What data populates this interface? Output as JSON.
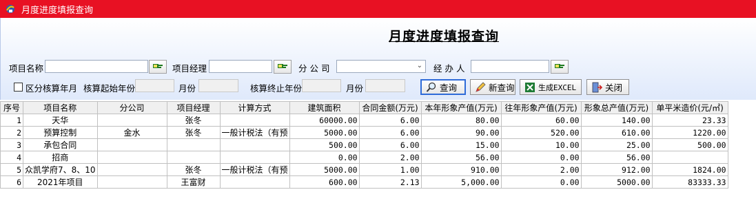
{
  "window": {
    "title": "月度进度填报查询"
  },
  "heading": "月度进度填报查询",
  "filters": {
    "project_name_label": "项目名称",
    "project_name_value": "",
    "manager_label": "项目经理",
    "manager_value": "",
    "branch_label": "分 公 司",
    "branch_value": "",
    "handler_label": "经 办 人",
    "handler_value": "",
    "split_label": "区分核算年月",
    "split_checked": false,
    "start_year_label": "核算起始年份",
    "start_month_label": "月份",
    "end_year_label": "核算终止年份",
    "end_month_label": "月份"
  },
  "buttons": {
    "query": "查询",
    "new_query": "新查询",
    "excel": "生成EXCEL",
    "close": "关闭"
  },
  "table": {
    "headers": [
      "序号",
      "项目名称",
      "分公司",
      "项目经理",
      "计算方式",
      "建筑面积",
      "合同金额(万元)",
      "本年形象产值(万元)",
      "往年形象产值(万元)",
      "形象总产值(万元)",
      "单平米造价(元/㎡)"
    ],
    "rows": [
      [
        "1",
        "天华",
        "",
        "张冬",
        "",
        "60000.00",
        "6.00",
        "80.00",
        "60.00",
        "140.00",
        "23.33"
      ],
      [
        "2",
        "预算控制",
        "金水",
        "张冬",
        "一般计税法（有预",
        "5000.00",
        "6.00",
        "90.00",
        "520.00",
        "610.00",
        "1220.00"
      ],
      [
        "3",
        "承包合同",
        "",
        "",
        "",
        "500.00",
        "6.00",
        "15.00",
        "10.00",
        "25.00",
        "500.00"
      ],
      [
        "4",
        "招商",
        "",
        "",
        "",
        "0.00",
        "2.00",
        "56.00",
        "0.00",
        "56.00",
        ""
      ],
      [
        "5",
        "众凯学府7、8、10",
        "",
        "张冬",
        "一般计税法（有预",
        "5000.00",
        "1.00",
        "910.00",
        "2.00",
        "912.00",
        "1824.00"
      ],
      [
        "6",
        "2021年项目",
        "",
        "王富财",
        "",
        "600.00",
        "2.13",
        "5,000.00",
        "0.00",
        "5000.00",
        "83333.33"
      ]
    ]
  }
}
